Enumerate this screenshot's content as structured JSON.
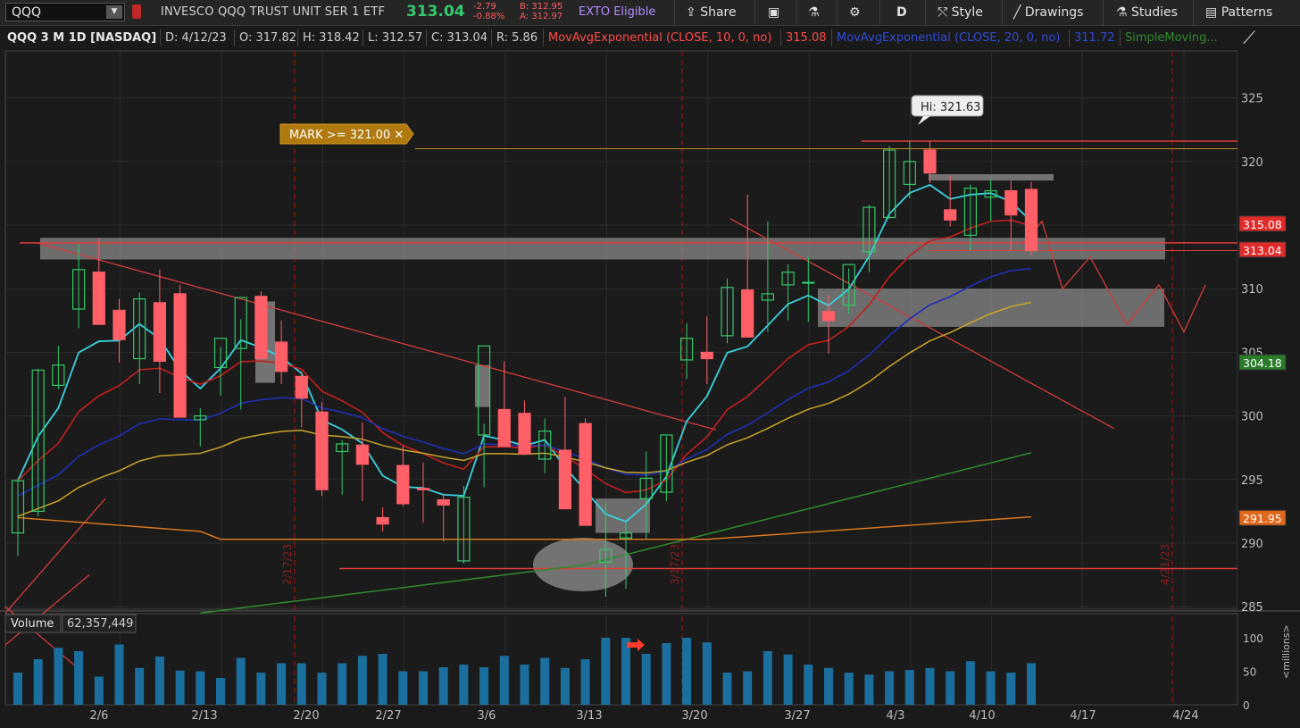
{
  "toolbar": {
    "symbol": "QQQ",
    "company": "INVESCO QQQ TRUST UNIT SER 1 ETF",
    "last": "313.04",
    "change": "-2.79",
    "change_pct": "-0.88%",
    "bid": "B: 312.95",
    "ask": "A: 312.97",
    "exto": "EXTO Eligible",
    "share": "Share",
    "period": "D",
    "style": "Style",
    "drawings": "Drawings",
    "studies": "Studies",
    "patterns": "Patterns"
  },
  "info": {
    "title": "QQQ 3 M 1D [NASDAQ]",
    "date": "D: 4/12/23",
    "open": "O: 317.82",
    "high": "H: 318.42",
    "low": "L: 312.57",
    "close": "C: 313.04",
    "range": "R: 5.86",
    "ema10_label": "MovAvgExponential (CLOSE, 10, 0, no)",
    "ema10_val": "315.08",
    "ema20_label": "MovAvgExponential (CLOSE, 20, 0, no)",
    "ema20_val": "311.72",
    "sma_label": "SimpleMoving..."
  },
  "colors": {
    "up": "#35c96b",
    "down": "#ff5f67",
    "ema10": "#c41e1e",
    "ema20": "#1e2fb5",
    "ema_cyan": "#3ad2e0",
    "sma_yellow": "#c9a42a",
    "sma_green": "#2f8a2f",
    "sma_orange": "#d9761e",
    "volume": "#1b6f9e"
  },
  "chart_data": {
    "type": "candlestick",
    "title": "QQQ 3 M 1D [NASDAQ]",
    "ylim": [
      283.5,
      328
    ],
    "y_ticks": [
      285,
      290,
      295,
      300,
      305,
      310,
      315,
      320,
      325
    ],
    "x_ticks": [
      "2/6",
      "2/13",
      "2/20",
      "2/27",
      "3/6",
      "3/13",
      "3/20",
      "3/27",
      "4/3",
      "4/10",
      "4/17",
      "4/24"
    ],
    "dates": [
      "1/30",
      "1/31",
      "2/1",
      "2/2",
      "2/3",
      "2/6",
      "2/7",
      "2/8",
      "2/9",
      "2/10",
      "2/13",
      "2/14",
      "2/15",
      "2/16",
      "2/17",
      "2/21",
      "2/22",
      "2/23",
      "2/24",
      "2/27",
      "2/28",
      "3/1",
      "3/2",
      "3/3",
      "3/6",
      "3/7",
      "3/8",
      "3/9",
      "3/10",
      "3/13",
      "3/14",
      "3/15",
      "3/16",
      "3/17",
      "3/20",
      "3/21",
      "3/22",
      "3/23",
      "3/24",
      "3/27",
      "3/28",
      "3/29",
      "3/30",
      "3/31",
      "4/3",
      "4/4",
      "4/5",
      "4/6",
      "4/10",
      "4/11",
      "4/12"
    ],
    "open": [
      290.8,
      292.5,
      302.4,
      308.4,
      311.3,
      308.3,
      304.5,
      308.9,
      309.6,
      299.7,
      303.8,
      305.3,
      309.4,
      305.8,
      303.1,
      300.3,
      297.2,
      297.7,
      292.0,
      296.1,
      294.3,
      293.4,
      288.6,
      298.5,
      300.5,
      300.2,
      296.6,
      297.3,
      299.4,
      288.5,
      290.4,
      293.5,
      294.0,
      304.4,
      305.0,
      306.3,
      309.9,
      309.1,
      310.3,
      310.5,
      308.2,
      308.7,
      312.9,
      315.6,
      318.2,
      320.9,
      316.2,
      314.2,
      317.2,
      317.7,
      317.8
    ],
    "high": [
      295.1,
      303.7,
      305.5,
      313.5,
      314.0,
      309.2,
      309.7,
      311.5,
      310.3,
      300.6,
      305.4,
      307.6,
      309.8,
      307.5,
      303.5,
      301.1,
      298.1,
      299.5,
      292.8,
      297.6,
      296.3,
      293.9,
      294.5,
      299.4,
      304.3,
      301.2,
      299.8,
      301.5,
      299.8,
      293.1,
      291.6,
      297.2,
      298.4,
      307.3,
      307.8,
      310.8,
      317.4,
      315.3,
      311.9,
      312.5,
      309.5,
      311.6,
      316.6,
      321.2,
      321.6,
      321.6,
      318.9,
      318.2,
      318.6,
      318.5,
      318.4
    ],
    "low": [
      289.0,
      292.1,
      302.1,
      306.9,
      309.0,
      304.2,
      302.5,
      301.8,
      300.6,
      297.6,
      301.6,
      300.5,
      304.4,
      302.5,
      299.1,
      293.7,
      293.8,
      293.3,
      290.9,
      292.9,
      291.6,
      290.1,
      288.4,
      294.4,
      299.8,
      299.6,
      295.5,
      295.1,
      292.1,
      285.8,
      286.4,
      290.3,
      293.3,
      302.9,
      302.5,
      305.7,
      306.2,
      306.6,
      307.5,
      307.4,
      304.9,
      308.0,
      311.3,
      315.5,
      317.1,
      318.3,
      314.9,
      313.0,
      315.3,
      313.0,
      312.6
    ],
    "close": [
      294.9,
      303.6,
      304.0,
      311.5,
      307.2,
      306.0,
      309.2,
      304.3,
      299.9,
      300.0,
      306.1,
      309.3,
      304.5,
      303.5,
      301.4,
      294.2,
      297.8,
      296.2,
      291.5,
      293.1,
      294.2,
      293.0,
      293.6,
      305.5,
      297.6,
      297.0,
      298.8,
      292.7,
      291.4,
      289.5,
      290.8,
      295.1,
      298.5,
      306.1,
      304.5,
      310.1,
      306.2,
      309.6,
      311.3,
      310.5,
      307.5,
      311.9,
      316.4,
      320.9,
      320.0,
      319.1,
      315.4,
      317.9,
      317.7,
      315.8,
      313.0
    ],
    "volume": [
      48,
      68,
      85,
      80,
      42,
      90,
      55,
      72,
      51,
      50,
      40,
      70,
      48,
      62,
      62,
      48,
      62,
      73,
      76,
      50,
      50,
      56,
      60,
      56,
      73,
      60,
      70,
      55,
      68,
      100,
      100,
      76,
      92,
      100,
      93,
      48,
      50,
      80,
      75,
      60,
      55,
      48,
      45,
      50,
      52,
      55,
      50,
      65,
      50,
      48,
      62
    ],
    "volume_axis": {
      "ticks": [
        0,
        50,
        100
      ],
      "unit": "millions"
    },
    "series": [
      {
        "name": "MovAvgExponential (CLOSE, 10, 0, no)",
        "last": 315.08
      },
      {
        "name": "MovAvgExponential (CLOSE, 20, 0, no)",
        "last": 311.72
      },
      {
        "name": "SimpleMoving...",
        "last": 304.18
      }
    ],
    "price_labels": {
      "ema10": "315.08",
      "close": "313.04",
      "sma50": "304.18",
      "sma200": "291.95"
    },
    "annotations": {
      "alert": "MARK >= 321.00",
      "alert_price": 321.0,
      "hi_bubble": "Hi: 321.63",
      "period_markers": [
        "2/17/23",
        "3/17/23",
        "4/21/23"
      ],
      "volume_label": "Volume",
      "volume_value": "62,357,449"
    }
  }
}
